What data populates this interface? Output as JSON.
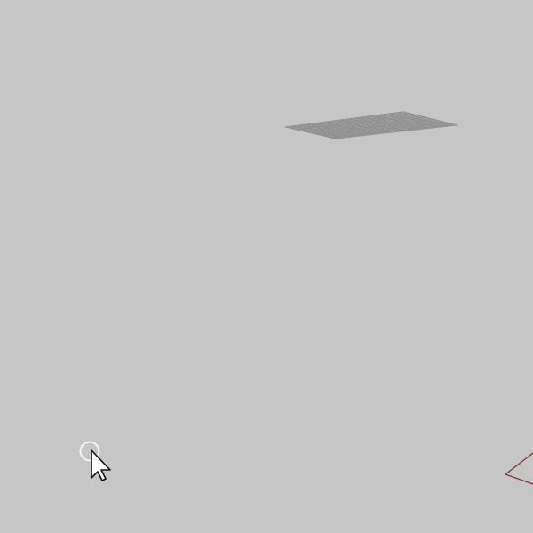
{
  "viewport": {
    "name": "perspective-viewport",
    "background_color": "#c6c6c6",
    "major_grid_color": "#8f8f8f",
    "minor_grid_color": "#b8b8b8",
    "axis_color": "#7a3b3b",
    "grid": {
      "major_lines_visible": true,
      "minor_lines_visible": true
    }
  },
  "cursor": {
    "icon": "arrow-pointer-icon",
    "snap_marker_icon": "snap-circle-icon"
  }
}
